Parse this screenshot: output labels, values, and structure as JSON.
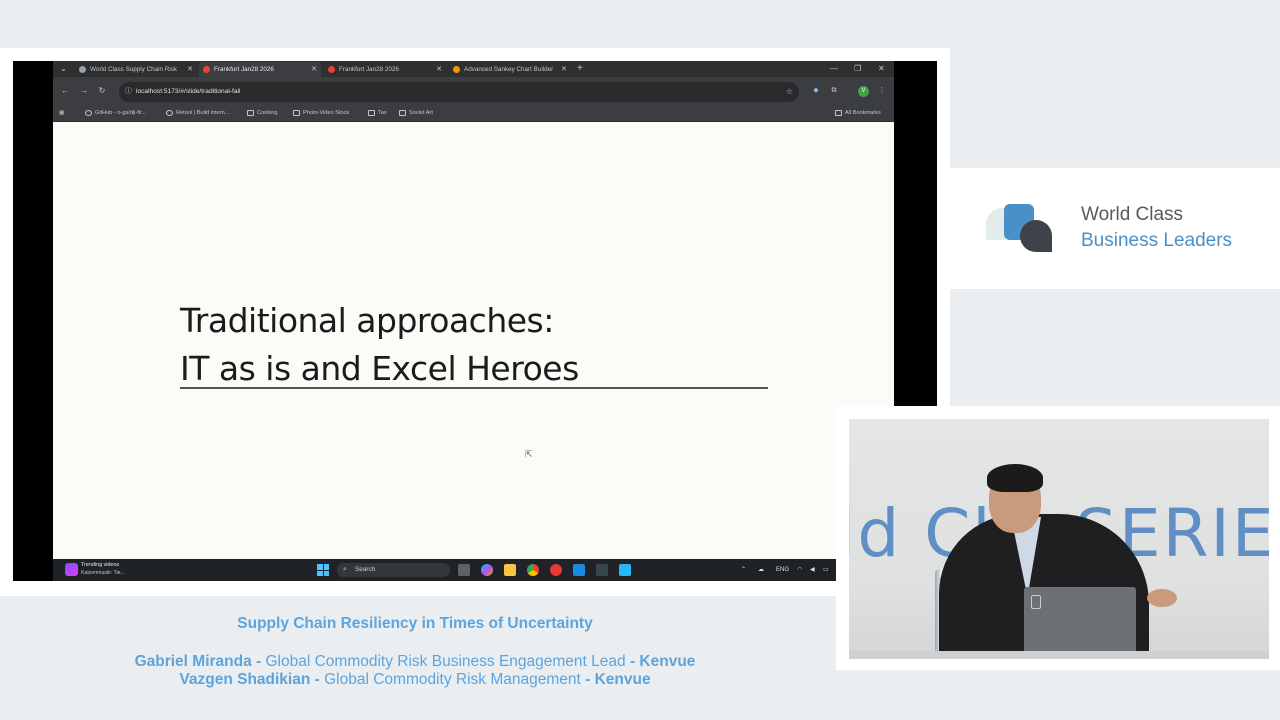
{
  "browser": {
    "tabs": [
      {
        "label": "World Class Supply Chain Risk",
        "active": false
      },
      {
        "label": "Frankfurt Jan28 2026",
        "active": true
      },
      {
        "label": "Frankfurt Jan28 2026",
        "active": false
      },
      {
        "label": "Advanced Sankey Chart Builder",
        "active": false
      }
    ],
    "url": "localhost:5173/#/slide/traditional-fail",
    "bookmarks": [
      "GitHub - o-gs/dji-fir...",
      "Retool | Build intern...",
      "Cooking",
      "Photo-Video Stock",
      "Tax",
      "Soviet Art"
    ],
    "all_bookmarks": "All Bookmarks",
    "profile_initial": "V"
  },
  "slide": {
    "title_line1": "Traditional approaches:",
    "title_line2": "IT as is and Excel Heroes"
  },
  "taskbar": {
    "widget_title": "Trending videos",
    "widget_subtitle": "Katzenmusik: Tie...",
    "search_label": "Search",
    "lang": "ENG"
  },
  "brand": {
    "line1": "World Class",
    "line2": "Business Leaders"
  },
  "webcam": {
    "backdrop_text": "ld Cl   s SERIE"
  },
  "caption": {
    "title": "Supply Chain Resiliency in Times of Uncertainty",
    "speaker1_name": "Gabriel Miranda -",
    "speaker1_role": "Global Commodity Risk Business Engagement Lead",
    "speaker1_company": "- Kenvue",
    "speaker2_name": "Vazgen Shadikian -",
    "speaker2_role": "Global Commodity Risk Management",
    "speaker2_company": "- Kenvue"
  },
  "colors": {
    "accent_blue": "#5da3dc",
    "brand_blue": "#4a90c8",
    "chrome_dark": "#3b3d40"
  }
}
